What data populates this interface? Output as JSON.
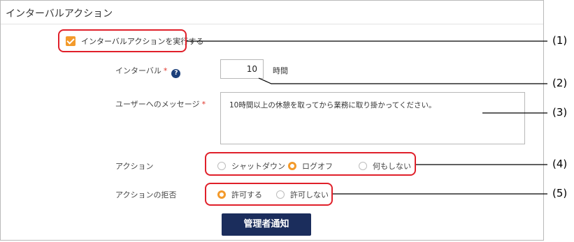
{
  "section": {
    "title": "インターバルアクション"
  },
  "execute_checkbox": {
    "label": "インターバルアクションを実行する",
    "checked": true
  },
  "interval": {
    "label": "インターバル",
    "required_mark": "*",
    "help_icon": "question-circle-icon",
    "value": "10",
    "unit": "時間"
  },
  "message": {
    "label": "ユーザーへのメッセージ",
    "required_mark": "*",
    "text": "10時間以上の休憩を取ってから業務に取り掛かってください。"
  },
  "action": {
    "label": "アクション",
    "options": [
      {
        "label": "シャットダウン",
        "selected": false
      },
      {
        "label": "ログオフ",
        "selected": true
      },
      {
        "label": "何もしない",
        "selected": false
      }
    ]
  },
  "refusal": {
    "label": "アクションの拒否",
    "options": [
      {
        "label": "許可する",
        "selected": true
      },
      {
        "label": "許可しない",
        "selected": false
      }
    ]
  },
  "notify_button": {
    "label": "管理者通知"
  },
  "callouts": [
    "(1)",
    "(2)",
    "(3)",
    "(4)",
    "(5)"
  ],
  "colors": {
    "accent": "#f39a2b",
    "button": "#1b2d5c",
    "callout": "#e0202a",
    "required": "#e0362b",
    "help": "#1b3f7a"
  }
}
